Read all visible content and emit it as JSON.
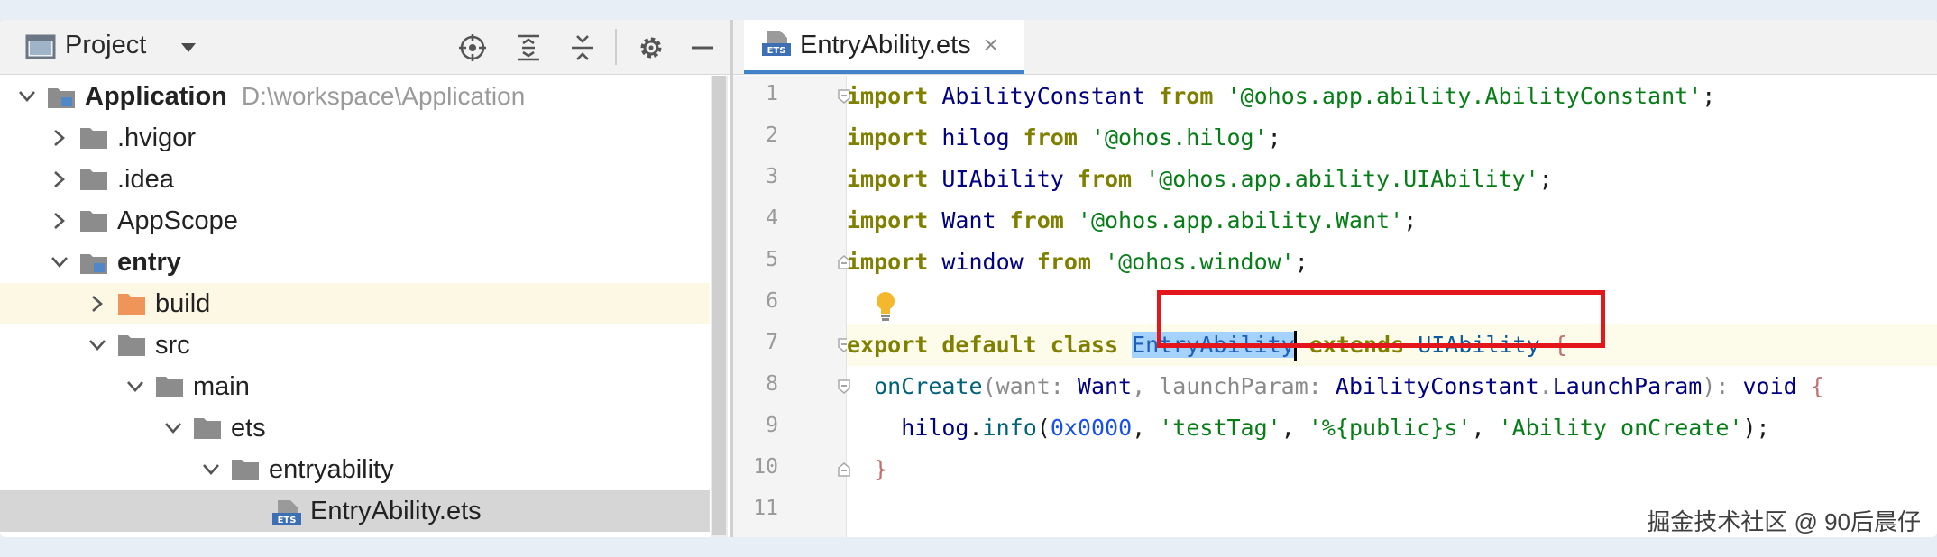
{
  "project_panel": {
    "title": "Project",
    "icons": [
      "project-view-icon",
      "dropdown-arrow-icon",
      "locate-icon",
      "expand-all-icon",
      "collapse-all-icon",
      "gear-icon",
      "hide-panel-icon"
    ],
    "tree": [
      {
        "label": "Application",
        "path": "D:\\workspace\\Application"
      },
      {
        "label": ".hvigor"
      },
      {
        "label": ".idea"
      },
      {
        "label": "AppScope"
      },
      {
        "label": "entry"
      },
      {
        "label": "build"
      },
      {
        "label": "src"
      },
      {
        "label": "main"
      },
      {
        "label": "ets"
      },
      {
        "label": "entryability"
      },
      {
        "label": "EntryAbility.ets"
      }
    ]
  },
  "editor": {
    "tab": {
      "label": "EntryAbility.ets",
      "close": "×",
      "icon_text": "ETS"
    },
    "line_numbers": [
      "1",
      "2",
      "3",
      "4",
      "5",
      "6",
      "7",
      "8",
      "9",
      "10",
      "11"
    ],
    "code": {
      "l1": {
        "kw1": "import",
        "name": " AbilityConstant ",
        "kw2": "from",
        "sp": " ",
        "str": "'@ohos.app.ability.AbilityConstant'",
        "end": ";"
      },
      "l2": {
        "kw1": "import",
        "name": " hilog ",
        "kw2": "from",
        "sp": " ",
        "str": "'@ohos.hilog'",
        "end": ";"
      },
      "l3": {
        "kw1": "import",
        "name": " UIAbility ",
        "kw2": "from",
        "sp": " ",
        "str": "'@ohos.app.ability.UIAbility'",
        "end": ";"
      },
      "l4": {
        "kw1": "import",
        "name": " Want ",
        "kw2": "from",
        "sp": " ",
        "str": "'@ohos.app.ability.Want'",
        "end": ";"
      },
      "l5": {
        "kw1": "import",
        "name": " window ",
        "kw2": "from",
        "sp": " ",
        "str": "'@ohos.window'",
        "end": ";"
      },
      "l7": {
        "kw": "export default class",
        "sp1": " ",
        "cls": "EntryAbility",
        "sp2": " ",
        "ext": "extends",
        "sp3": " ",
        "base": "UIAbility",
        "sp4": " ",
        "brace": "{"
      },
      "l8": {
        "indent": "  ",
        "fn": "onCreate",
        "p1": "(want: ",
        "t1": "Want",
        "p2": ", launchParam: ",
        "t2": "AbilityConstant",
        "dot": ".",
        "t3": "LaunchParam",
        "p3": "): ",
        "kw": "void",
        "sp": " ",
        "brace": "{"
      },
      "l9": {
        "indent": "    ",
        "obj": "hilog",
        "dot": ".",
        "fn": "info",
        "p1": "(",
        "num": "0x0000",
        "c1": ", ",
        "s1": "'testTag'",
        "c2": ", ",
        "s2": "'%{public}s'",
        "c3": ", ",
        "s3": "'Ability onCreate'",
        "end": ");"
      },
      "l10": {
        "indent": "  ",
        "brace": "}"
      }
    }
  },
  "watermark": "掘金技术社区 @ 90后晨仔",
  "colors": {
    "keyword": "#808000",
    "string": "#067d17",
    "annotation_box": "#e3161b",
    "selection": "#a6d2ff",
    "folder": "#8c8c8c",
    "build_folder": "#f0955a"
  }
}
